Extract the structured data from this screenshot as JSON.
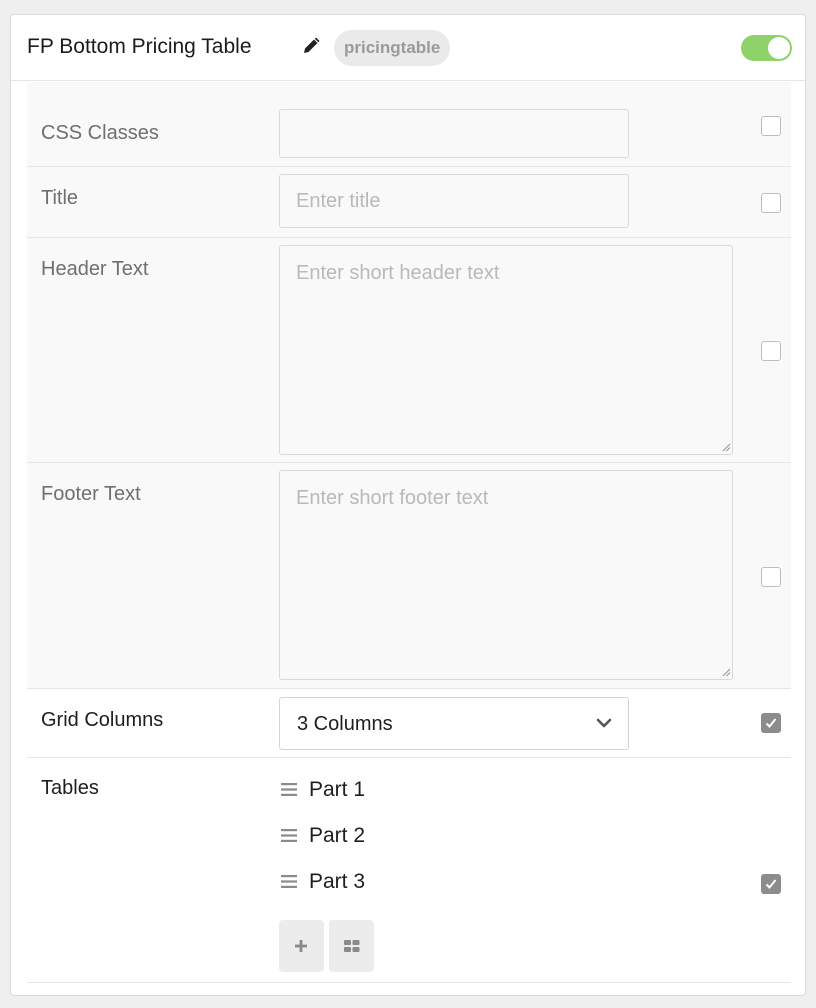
{
  "header": {
    "title": "FP Bottom Pricing Table",
    "badge": "pricingtable",
    "edit_icon": "pencil-icon",
    "toggle_on": true,
    "toggle_color": "#8fd26a"
  },
  "fields": {
    "css_classes": {
      "label": "CSS Classes",
      "value": "",
      "placeholder": ""
    },
    "title": {
      "label": "Title",
      "value": "",
      "placeholder": "Enter title"
    },
    "header_text": {
      "label": "Header Text",
      "value": "",
      "placeholder": "Enter short header text"
    },
    "footer_text": {
      "label": "Footer Text",
      "value": "",
      "placeholder": "Enter short footer text"
    },
    "grid_columns": {
      "label": "Grid Columns",
      "selected": "3 Columns"
    },
    "tables": {
      "label": "Tables",
      "items": [
        "Part 1",
        "Part 2",
        "Part 3"
      ],
      "add_icon": "plus-icon",
      "grid_icon": "grid-icon"
    }
  },
  "checkboxes": {
    "css_classes": false,
    "title": false,
    "header_text": false,
    "footer_text": false,
    "grid_columns": true,
    "tables": true
  }
}
